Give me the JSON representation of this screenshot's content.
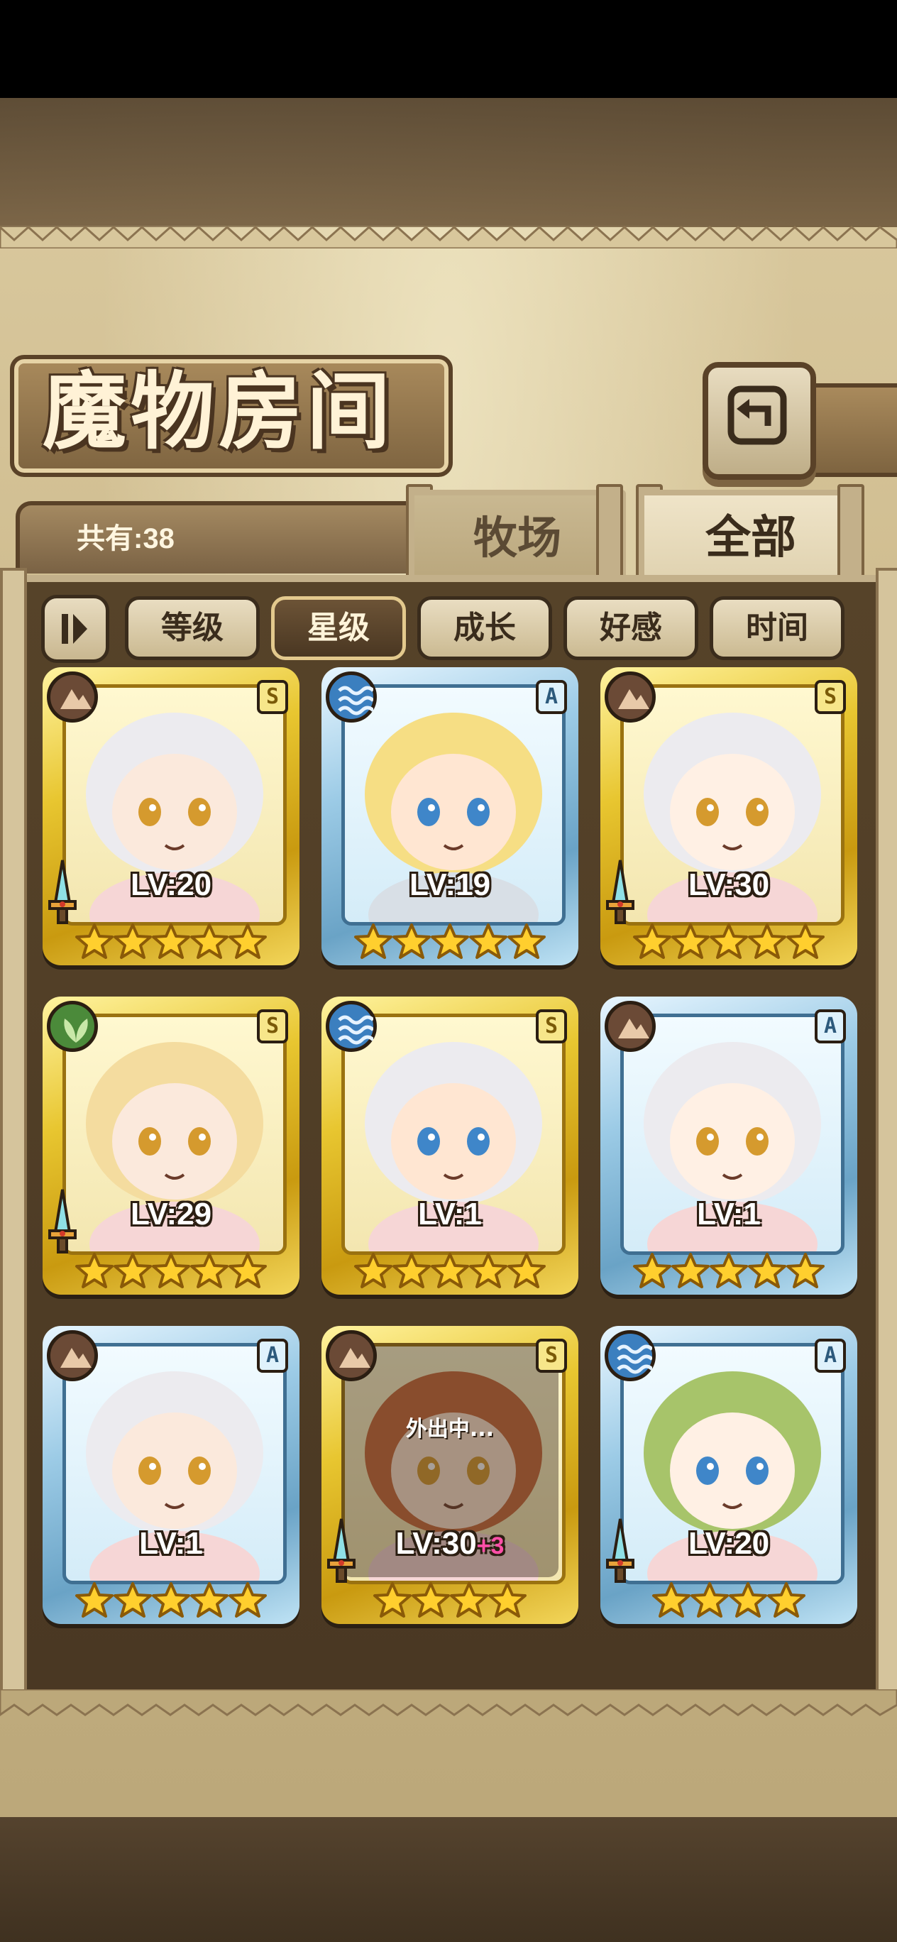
{
  "header": {
    "title": "魔物房间",
    "back_icon": "back-return-icon"
  },
  "collection": {
    "count_label": "共有:38"
  },
  "tabs": [
    {
      "label": "牧场",
      "active": false
    },
    {
      "label": "全部",
      "active": true
    }
  ],
  "sort_options": [
    {
      "label": "等级",
      "active": false
    },
    {
      "label": "星级",
      "active": true
    },
    {
      "label": "成长",
      "active": false
    },
    {
      "label": "好感",
      "active": false
    },
    {
      "label": "时间",
      "active": false
    }
  ],
  "monsters": [
    {
      "level": "LV:20",
      "rank": "S",
      "element": "earth",
      "stars": 5,
      "frame": "gold",
      "weapon": true,
      "status": "",
      "level_bonus": ""
    },
    {
      "level": "LV:19",
      "rank": "A",
      "element": "water",
      "stars": 5,
      "frame": "blue",
      "weapon": false,
      "status": "",
      "level_bonus": ""
    },
    {
      "level": "LV:30",
      "rank": "S",
      "element": "earth",
      "stars": 5,
      "frame": "gold",
      "weapon": true,
      "status": "",
      "level_bonus": ""
    },
    {
      "level": "LV:29",
      "rank": "S",
      "element": "leaf",
      "stars": 5,
      "frame": "gold",
      "weapon": true,
      "status": "",
      "level_bonus": ""
    },
    {
      "level": "LV:1",
      "rank": "S",
      "element": "water",
      "stars": 5,
      "frame": "gold",
      "weapon": false,
      "status": "",
      "level_bonus": ""
    },
    {
      "level": "LV:1",
      "rank": "A",
      "element": "earth",
      "stars": 5,
      "frame": "blue",
      "weapon": false,
      "status": "",
      "level_bonus": ""
    },
    {
      "level": "LV:1",
      "rank": "A",
      "element": "earth",
      "stars": 5,
      "frame": "blue",
      "weapon": false,
      "status": "",
      "level_bonus": ""
    },
    {
      "level": "LV:30",
      "rank": "S",
      "element": "earth",
      "stars": 4,
      "frame": "gold",
      "weapon": true,
      "status": "外出中...",
      "level_bonus": "+3"
    },
    {
      "level": "LV:20",
      "rank": "A",
      "element": "water",
      "stars": 4,
      "frame": "blue",
      "weapon": true,
      "status": "",
      "level_bonus": ""
    }
  ],
  "colors": {
    "gold_frame": "#e8c630",
    "blue_frame": "#6aa3c6",
    "board": "#4a3823",
    "parchment": "#cbb789"
  }
}
